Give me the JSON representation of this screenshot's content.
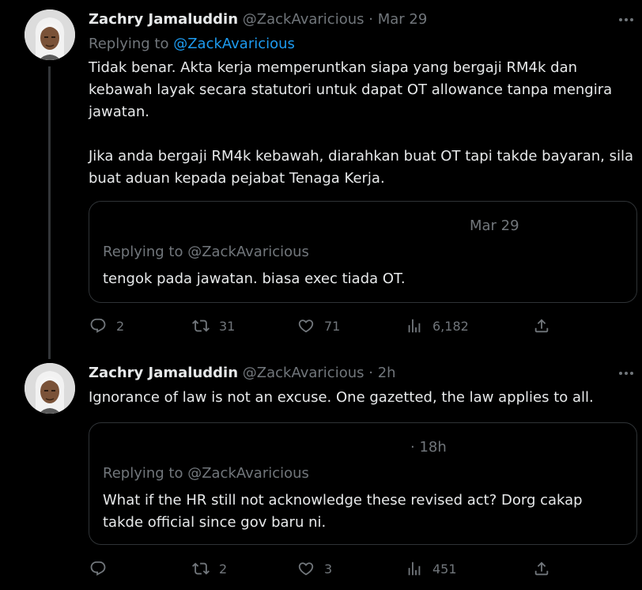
{
  "tweets": [
    {
      "author": {
        "name": "Zachry Jamaluddin",
        "handle": "@ZackAvaricious"
      },
      "dot": "·",
      "time": "Mar 29",
      "replying_prefix": "Replying to ",
      "replying_handle": "@ZackAvaricious",
      "text": [
        "Tidak benar. Akta kerja memperuntkan siapa yang bergaji RM4k dan kebawah layak secara statutori untuk dapat OT allowance tanpa mengira jawatan.",
        "Jika anda bergaji RM4k kebawah, diarahkan buat OT tapi takde bayaran, sila buat aduan kepada pejabat Tenaga Kerja."
      ],
      "quote": {
        "time": "Mar 29",
        "replying": "Replying to @ZackAvaricious",
        "text": "tengok pada jawatan. biasa exec tiada OT."
      },
      "stats": {
        "replies": "2",
        "retweets": "31",
        "likes": "71",
        "views": "6,182"
      }
    },
    {
      "author": {
        "name": "Zachry Jamaluddin",
        "handle": "@ZackAvaricious"
      },
      "dot": "·",
      "time": "2h",
      "text": [
        "Ignorance of law is not an excuse. One gazetted, the law applies to all."
      ],
      "quote": {
        "time": "· 18h",
        "replying": "Replying to @ZackAvaricious",
        "text": "What if the HR still not acknowledge these revised act? Dorg cakap takde official since gov baru ni."
      },
      "stats": {
        "replies": "",
        "retweets": "2",
        "likes": "3",
        "views": "451"
      }
    }
  ],
  "colors": {
    "background": "#000000",
    "text_primary": "#e7e9ea",
    "text_secondary": "#71767b",
    "link": "#1d9bf0",
    "border": "#2f3336"
  },
  "icons": {
    "more": "more-icon",
    "reply": "reply-icon",
    "retweet": "retweet-icon",
    "like": "like-icon",
    "views": "views-icon",
    "share": "share-icon"
  }
}
